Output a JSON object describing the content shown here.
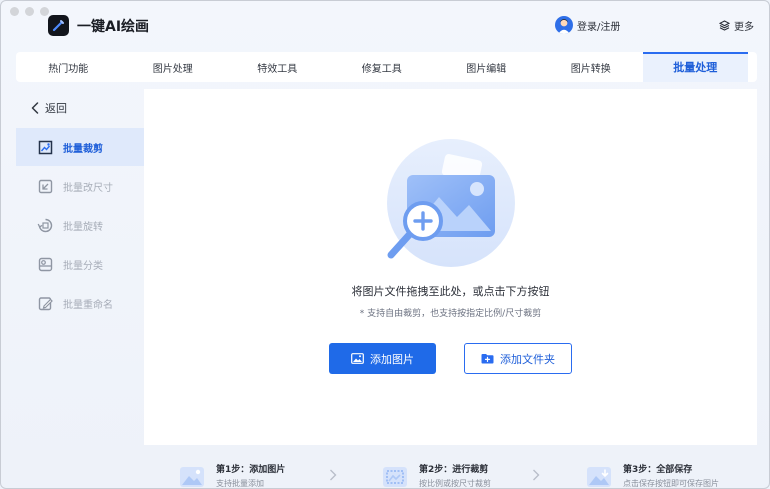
{
  "app": {
    "title": "一键AI绘画"
  },
  "header": {
    "login_label": "登录/注册",
    "more_label": "更多"
  },
  "tabs": [
    {
      "label": "热门功能",
      "active": false
    },
    {
      "label": "图片处理",
      "active": false
    },
    {
      "label": "特效工具",
      "active": false
    },
    {
      "label": "修复工具",
      "active": false
    },
    {
      "label": "图片编辑",
      "active": false
    },
    {
      "label": "图片转换",
      "active": false
    },
    {
      "label": "批量处理",
      "active": true
    }
  ],
  "sidebar": {
    "back_label": "返回",
    "items": [
      {
        "label": "批量裁剪",
        "icon": "crop-icon",
        "active": true
      },
      {
        "label": "批量改尺寸",
        "icon": "resize-icon",
        "active": false
      },
      {
        "label": "批量旋转",
        "icon": "rotate-icon",
        "active": false
      },
      {
        "label": "批量分类",
        "icon": "classify-icon",
        "active": false
      },
      {
        "label": "批量重命名",
        "icon": "rename-icon",
        "active": false
      }
    ]
  },
  "main": {
    "headline": "将图片文件拖拽至此处，或点击下方按钮",
    "subline": "* 支持自由裁剪，也支持按指定比例/尺寸裁剪",
    "add_image_label": "添加图片",
    "add_folder_label": "添加文件夹"
  },
  "steps": [
    {
      "title": "第1步：添加图片",
      "desc": "支持批量添加"
    },
    {
      "title": "第2步：进行裁剪",
      "desc": "按比例或按尺寸裁剪"
    },
    {
      "title": "第3步：全部保存",
      "desc": "点击保存按钮即可保存图片"
    }
  ],
  "colors": {
    "accent": "#1f6ae8",
    "active_tab_bg": "#eaf1fd",
    "sidebar_active_bg": "#dfe9fb"
  }
}
